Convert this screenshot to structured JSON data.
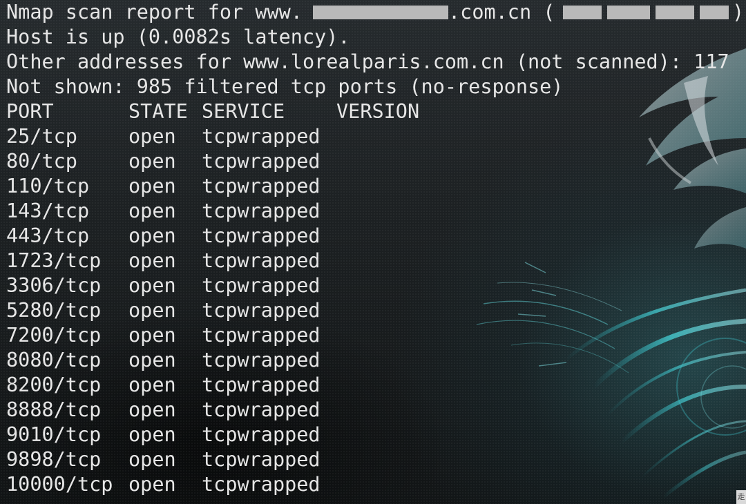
{
  "header_lines": {
    "scan_report": {
      "prefix": "Nmap scan report for www.",
      "suffix": ".com.cn (",
      "end": ")"
    },
    "host_status": "Host is up (0.0082s latency).",
    "other_addresses": "Other addresses for www.lorealparis.com.cn (not scanned): 117",
    "not_shown": "Not shown: 985 filtered tcp ports (no-response)"
  },
  "table": {
    "headers": {
      "port": "PORT",
      "state": "STATE",
      "service": "SERVICE",
      "version": "VERSION"
    },
    "rows": [
      {
        "port": "25/tcp",
        "state": "open",
        "service": "tcpwrapped"
      },
      {
        "port": "80/tcp",
        "state": "open",
        "service": "tcpwrapped"
      },
      {
        "port": "110/tcp",
        "state": "open",
        "service": "tcpwrapped"
      },
      {
        "port": "143/tcp",
        "state": "open",
        "service": "tcpwrapped"
      },
      {
        "port": "443/tcp",
        "state": "open",
        "service": "tcpwrapped"
      },
      {
        "port": "1723/tcp",
        "state": "open",
        "service": "tcpwrapped"
      },
      {
        "port": "3306/tcp",
        "state": "open",
        "service": "tcpwrapped"
      },
      {
        "port": "5280/tcp",
        "state": "open",
        "service": "tcpwrapped"
      },
      {
        "port": "7200/tcp",
        "state": "open",
        "service": "tcpwrapped"
      },
      {
        "port": "8080/tcp",
        "state": "open",
        "service": "tcpwrapped"
      },
      {
        "port": "8200/tcp",
        "state": "open",
        "service": "tcpwrapped"
      },
      {
        "port": "8888/tcp",
        "state": "open",
        "service": "tcpwrapped"
      },
      {
        "port": "9010/tcp",
        "state": "open",
        "service": "tcpwrapped"
      },
      {
        "port": "9898/tcp",
        "state": "open",
        "service": "tcpwrapped"
      },
      {
        "port": "10000/tcp",
        "state": "open",
        "service": "tcpwrapped"
      }
    ]
  },
  "corner_tag": "走",
  "colors": {
    "text": "#e6e6e6",
    "background": "#1b1f21",
    "accent": "#5fd3d8",
    "redaction": "#b9b9b9"
  },
  "icons": {
    "wallpaper": "kali-dragon-icon"
  }
}
